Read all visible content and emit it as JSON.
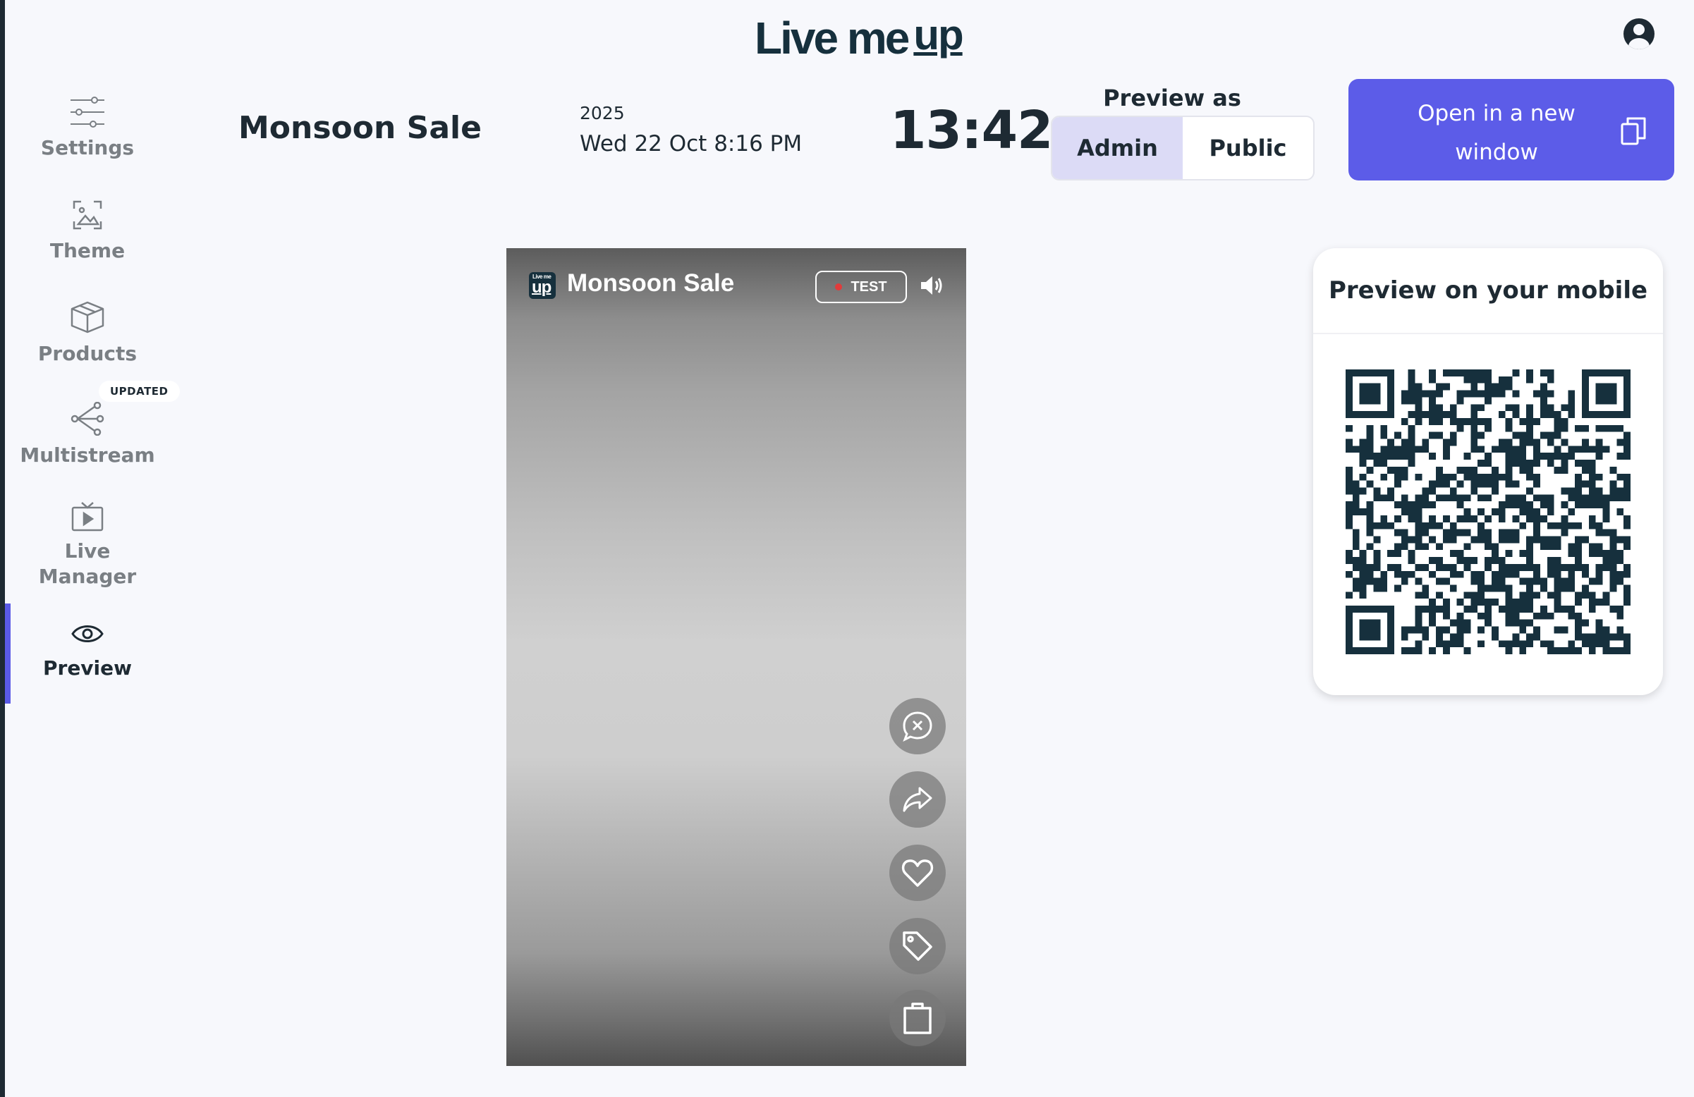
{
  "header": {
    "logo_text": "Live me",
    "logo_up": "up"
  },
  "sidebar": {
    "items": [
      {
        "label": "Settings",
        "icon": "sliders-icon"
      },
      {
        "label": "Theme",
        "icon": "image-icon"
      },
      {
        "label": "Products",
        "icon": "box-icon"
      },
      {
        "label": "Multistream",
        "icon": "share-nodes-icon",
        "badge": "UPDATED"
      },
      {
        "label": "Live",
        "label2": "Manager",
        "icon": "tv-play-icon"
      },
      {
        "label": "Preview",
        "icon": "eye-icon",
        "active": true
      }
    ]
  },
  "event": {
    "title": "Monsoon Sale",
    "year": "2025",
    "date": "Wed 22 Oct 8:16 PM",
    "countdown": "13:42"
  },
  "preview_as": {
    "label": "Preview as",
    "options": [
      "Admin",
      "Public"
    ],
    "selected": "Admin"
  },
  "open_window": {
    "label_line1": "Open in a new",
    "label_line2": "window"
  },
  "phone": {
    "title": "Monsoon Sale",
    "badge": "TEST",
    "logo_small": "Live me",
    "logo_big": "up",
    "actions": [
      "close-chat-icon",
      "share-icon",
      "heart-icon",
      "tag-icon",
      "shopping-bag-icon"
    ]
  },
  "mobile_card": {
    "title": "Preview on your mobile"
  },
  "colors": {
    "accent": "#5c5ce8",
    "selected_segment": "#dcdbf6",
    "dark": "#1e2a33",
    "muted": "#7a7f84",
    "live_dot": "#e23b3b"
  }
}
